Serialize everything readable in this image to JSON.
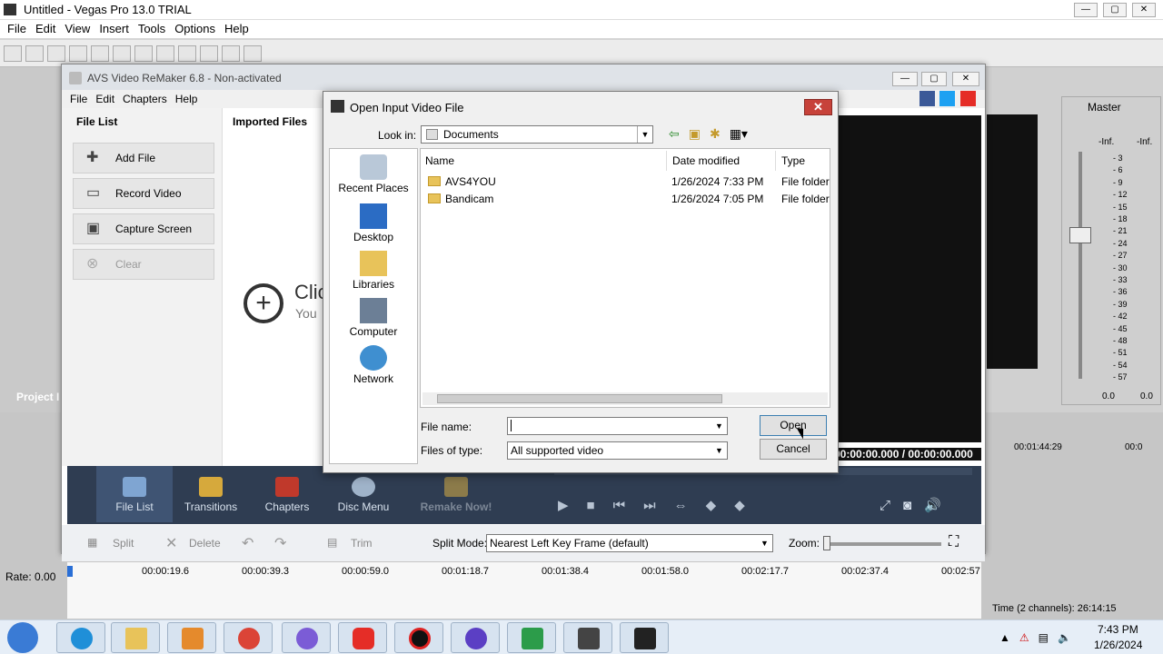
{
  "vegas": {
    "title": "Untitled - Vegas Pro 13.0 TRIAL",
    "menu": [
      "File",
      "Edit",
      "View",
      "Insert",
      "Tools",
      "Options",
      "Help"
    ],
    "project_label": "Project I",
    "master_label": "Master",
    "inf_left": "-Inf.",
    "inf_right": "-Inf.",
    "meter_scale": [
      "3",
      "6",
      "9",
      "12",
      "15",
      "18",
      "21",
      "24",
      "27",
      "30",
      "33",
      "36",
      "39",
      "42",
      "45",
      "48",
      "51",
      "54",
      "57"
    ],
    "meter_values": [
      "0.0",
      "0.0"
    ],
    "time_readout": "00:00:00.000 / 00:00:00.000",
    "right_time": "00:01:44:29",
    "right_time2": "00:0",
    "rate": "Rate: 0.00",
    "status": "Time (2 channels): 26:14:15"
  },
  "avs": {
    "title": "AVS Video ReMaker 6.8 - Non-activated",
    "menu": [
      "File",
      "Edit",
      "Chapters",
      "Help"
    ],
    "file_list_label": "File List",
    "imported_files_label": "Imported Files",
    "buttons": [
      "Add File",
      "Record Video",
      "Capture Screen",
      "Clear"
    ],
    "click_text": "Clic",
    "you_text": "You",
    "bottom_tabs": [
      "File List",
      "Transitions",
      "Chapters",
      "Disc Menu",
      "Remake Now!"
    ],
    "edit_tools": [
      "Split",
      "Delete",
      "Trim"
    ],
    "split_mode_label": "Split Mode:",
    "split_mode_value": "Nearest Left Key Frame (default)",
    "zoom_label": "Zoom:",
    "ruler": [
      "00:00:19.6",
      "00:00:39.3",
      "00:00:59.0",
      "00:01:18.7",
      "00:01:38.4",
      "00:01:58.0",
      "00:02:17.7",
      "00:02:37.4",
      "00:02:57"
    ]
  },
  "dialog": {
    "title": "Open Input Video File",
    "look_in_label": "Look in:",
    "look_in_value": "Documents",
    "places": [
      "Recent Places",
      "Desktop",
      "Libraries",
      "Computer",
      "Network"
    ],
    "columns": [
      "Name",
      "Date modified",
      "Type"
    ],
    "files": [
      {
        "name": "AVS4YOU",
        "date": "1/26/2024 7:33 PM",
        "type": "File folder"
      },
      {
        "name": "Bandicam",
        "date": "1/26/2024 7:05 PM",
        "type": "File folder"
      }
    ],
    "file_name_label": "File name:",
    "file_name_value": "",
    "files_of_type_label": "Files of type:",
    "files_of_type_value": "All supported video",
    "open_label": "Open",
    "cancel_label": "Cancel"
  },
  "taskbar": {
    "time": "7:43 PM",
    "date": "1/26/2024",
    "icons": [
      "start-orb-icon",
      "edge-icon",
      "file-explorer-icon",
      "media-icon",
      "chrome-icon",
      "copilot-icon",
      "youtube-icon",
      "record-icon",
      "headphones-icon",
      "sync-icon",
      "vegas-icon",
      "avs-icon"
    ]
  },
  "colors": {
    "taskbar": "#e6eef7",
    "avs_bottom": "#2f3d52",
    "close": "#c7423a"
  }
}
